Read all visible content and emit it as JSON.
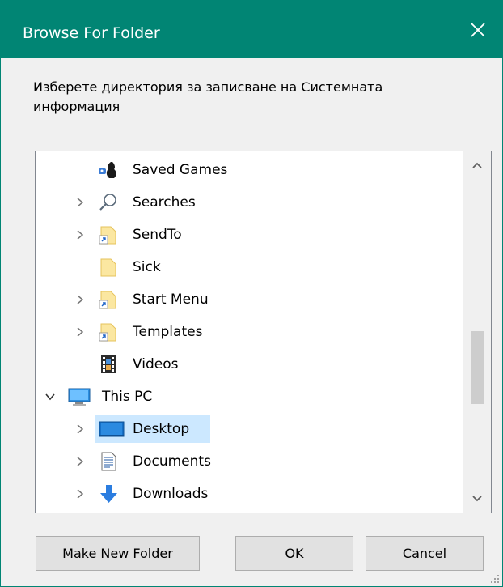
{
  "window": {
    "title": "Browse For Folder",
    "accent_color": "#018574"
  },
  "instruction": "Изберете директория за записване на Системната информация",
  "tree": {
    "items": [
      {
        "label": "Saved Games",
        "icon": "saved-games-icon",
        "has_children": false,
        "level": 2
      },
      {
        "label": "Searches",
        "icon": "search-icon",
        "has_children": true,
        "level": 2
      },
      {
        "label": "SendTo",
        "icon": "shortcut-folder-icon",
        "has_children": true,
        "level": 2
      },
      {
        "label": "Sick",
        "icon": "folder-icon",
        "has_children": false,
        "level": 2
      },
      {
        "label": "Start Menu",
        "icon": "shortcut-folder-icon",
        "has_children": true,
        "level": 2
      },
      {
        "label": "Templates",
        "icon": "shortcut-folder-icon",
        "has_children": true,
        "level": 2
      },
      {
        "label": "Videos",
        "icon": "film-icon",
        "has_children": false,
        "level": 2
      },
      {
        "label": "This PC",
        "icon": "computer-icon",
        "has_children": true,
        "expanded": true,
        "level": 1
      },
      {
        "label": "Desktop",
        "icon": "desktop-icon",
        "has_children": true,
        "level": 2,
        "selected": true
      },
      {
        "label": "Documents",
        "icon": "documents-icon",
        "has_children": true,
        "level": 2
      },
      {
        "label": "Downloads",
        "icon": "download-arrow-icon",
        "has_children": true,
        "level": 2
      }
    ]
  },
  "buttons": {
    "make_new_folder": "Make New Folder",
    "ok": "OK",
    "cancel": "Cancel"
  }
}
